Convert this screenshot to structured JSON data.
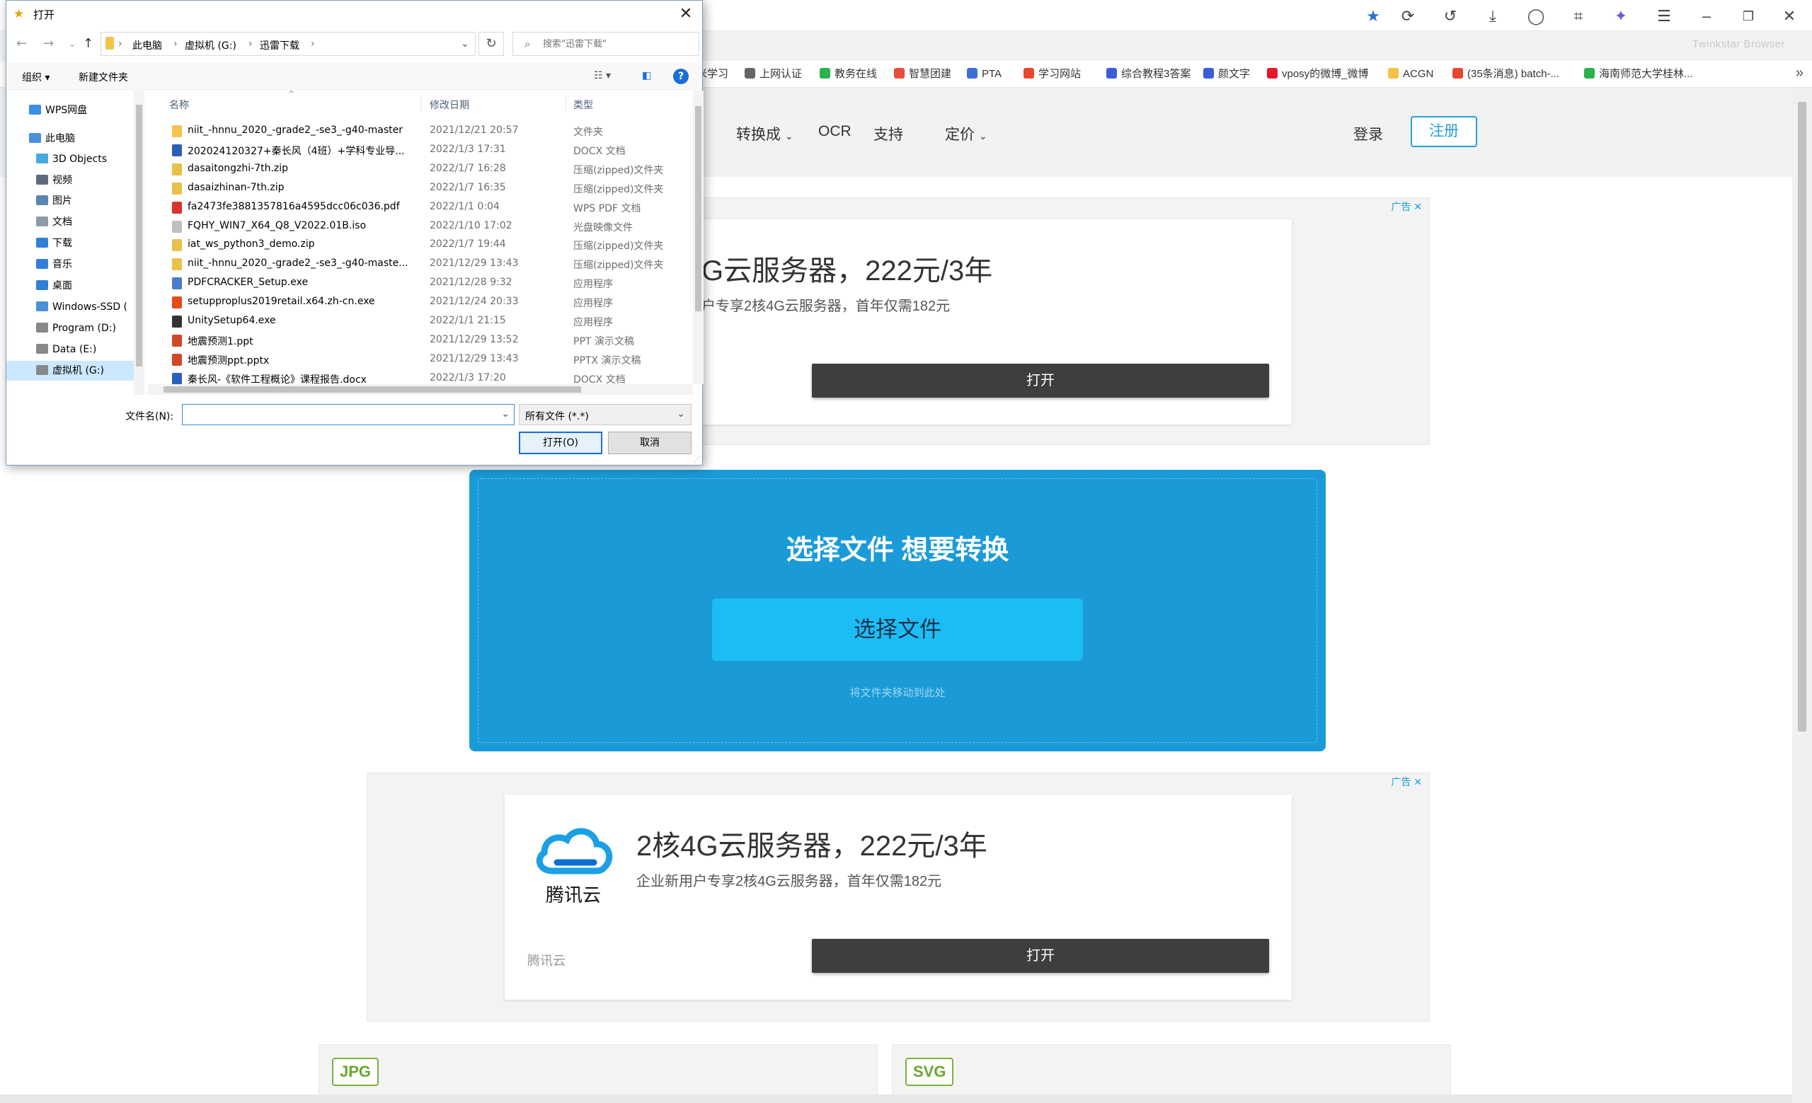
{
  "browser": {
    "brand": "Twinkstar Browser",
    "bookmarks": [
      {
        "label": "米学习",
        "color": "#f5a623"
      },
      {
        "label": "上网认证",
        "color": "#666666"
      },
      {
        "label": "教务在线",
        "color": "#2bb24c"
      },
      {
        "label": "智慧团建",
        "color": "#e84d3c"
      },
      {
        "label": "PTA",
        "color": "#3b6fd6"
      },
      {
        "label": "学习网站",
        "color": "#e8462f"
      },
      {
        "label": "综合教程3答案",
        "color": "#3b5bdb"
      },
      {
        "label": "颜文字",
        "color": "#3b5bdb"
      },
      {
        "label": "vposy的微博_微博",
        "color": "#e6162d"
      },
      {
        "label": "ACGN",
        "color": "#f5c242"
      },
      {
        "label": "(35条消息) batch-...",
        "color": "#e8462f"
      },
      {
        "label": "海南师范大学桂林...",
        "color": "#2bb24c"
      }
    ]
  },
  "site": {
    "nav": {
      "convert": "转换成",
      "ocr": "OCR",
      "support": "支持",
      "pricing": "定价"
    },
    "login": "登录",
    "register": "注册"
  },
  "ads": {
    "mark": "广告",
    "title": "2核4G云服务器，222元/3年",
    "title_partial": "G云服务器，222元/3年",
    "subtitle": "企业新用户专享2核4G云服务器，首年仅需182元",
    "subtitle_partial": "户专享2核4G云服务器，首年仅需182元",
    "open": "打开",
    "brand": "腾讯云",
    "logo_text": "腾讯云"
  },
  "upload": {
    "title": "选择文件 想要转换",
    "button": "选择文件",
    "hint": "将文件夹移动到此处"
  },
  "formats": [
    "JPG",
    "SVG"
  ],
  "dialog": {
    "title": "打开",
    "breadcrumbs": [
      "此电脑",
      "虚拟机 (G:)",
      "迅雷下载"
    ],
    "search_placeholder": "搜索\"迅雷下载\"",
    "toolbar": {
      "organize": "组织 ▾",
      "new_folder": "新建文件夹"
    },
    "nav_items": [
      {
        "label": "WPS网盘",
        "indent": 0,
        "color": "#3a8ee6"
      },
      {
        "label": "此电脑",
        "indent": 0,
        "color": "#4a90d9"
      },
      {
        "label": "3D Objects",
        "indent": 1,
        "color": "#49a8e0"
      },
      {
        "label": "视频",
        "indent": 1,
        "color": "#5b6b7c"
      },
      {
        "label": "图片",
        "indent": 1,
        "color": "#5b86b0"
      },
      {
        "label": "文档",
        "indent": 1,
        "color": "#8c9aa8"
      },
      {
        "label": "下载",
        "indent": 1,
        "color": "#2f7fd8"
      },
      {
        "label": "音乐",
        "indent": 1,
        "color": "#2f7fd8"
      },
      {
        "label": "桌面",
        "indent": 1,
        "color": "#2f7fd8"
      },
      {
        "label": "Windows-SSD (",
        "indent": 1,
        "color": "#4a90d9"
      },
      {
        "label": "Program (D:)",
        "indent": 1,
        "color": "#888888"
      },
      {
        "label": "Data (E:)",
        "indent": 1,
        "color": "#888888"
      },
      {
        "label": "虚拟机 (G:)",
        "indent": 1,
        "color": "#888888",
        "selected": true
      }
    ],
    "columns": {
      "name": "名称",
      "date": "修改日期",
      "type": "类型"
    },
    "files": [
      {
        "name": "niit_-hnnu_2020_-grade2_-se3_-g40-master",
        "date": "2021/12/21 20:57",
        "type": "文件夹",
        "color": "#f2c44d"
      },
      {
        "name": "202024120327+秦长风（4班）+学科专业导...",
        "date": "2022/1/3 17:31",
        "type": "DOCX 文档",
        "color": "#2b5fb8"
      },
      {
        "name": "dasaitongzhi-7th.zip",
        "date": "2022/1/7 16:28",
        "type": "压缩(zipped)文件夹",
        "color": "#e8c14a"
      },
      {
        "name": "dasaizhinan-7th.zip",
        "date": "2022/1/7 16:35",
        "type": "压缩(zipped)文件夹",
        "color": "#e8c14a"
      },
      {
        "name": "fa2473fe3881357816a4595dcc06c036.pdf",
        "date": "2022/1/1 0:04",
        "type": "WPS PDF 文档",
        "color": "#d9342b"
      },
      {
        "name": "FQHY_WIN7_X64_Q8_V2022.01B.iso",
        "date": "2022/1/10 17:02",
        "type": "光盘映像文件",
        "color": "#bfbfbf"
      },
      {
        "name": "iat_ws_python3_demo.zip",
        "date": "2022/1/7 19:44",
        "type": "压缩(zipped)文件夹",
        "color": "#e8c14a"
      },
      {
        "name": "niit_-hnnu_2020_-grade2_-se3_-g40-maste...",
        "date": "2021/12/29 13:43",
        "type": "压缩(zipped)文件夹",
        "color": "#e8c14a"
      },
      {
        "name": "PDFCRACKER_Setup.exe",
        "date": "2021/12/28 9:32",
        "type": "应用程序",
        "color": "#4a7cc9"
      },
      {
        "name": "setupproplus2019retail.x64.zh-cn.exe",
        "date": "2021/12/24 20:33",
        "type": "应用程序",
        "color": "#e64a19"
      },
      {
        "name": "UnitySetup64.exe",
        "date": "2022/1/1 21:15",
        "type": "应用程序",
        "color": "#333333"
      },
      {
        "name": "地震预测1.ppt",
        "date": "2021/12/29 13:52",
        "type": "PPT 演示文稿",
        "color": "#d24726"
      },
      {
        "name": "地震预测ppt.pptx",
        "date": "2021/12/29 13:43",
        "type": "PPTX 演示文稿",
        "color": "#d24726"
      },
      {
        "name": "秦长风-《软件工程概论》课程报告.docx",
        "date": "2022/1/3 17:20",
        "type": "DOCX 文档",
        "color": "#2b5fb8"
      }
    ],
    "filename_label": "文件名(N):",
    "filename_value": "",
    "filetype": "所有文件 (*.*)",
    "open_button": "打开(O)",
    "cancel_button": "取消"
  }
}
